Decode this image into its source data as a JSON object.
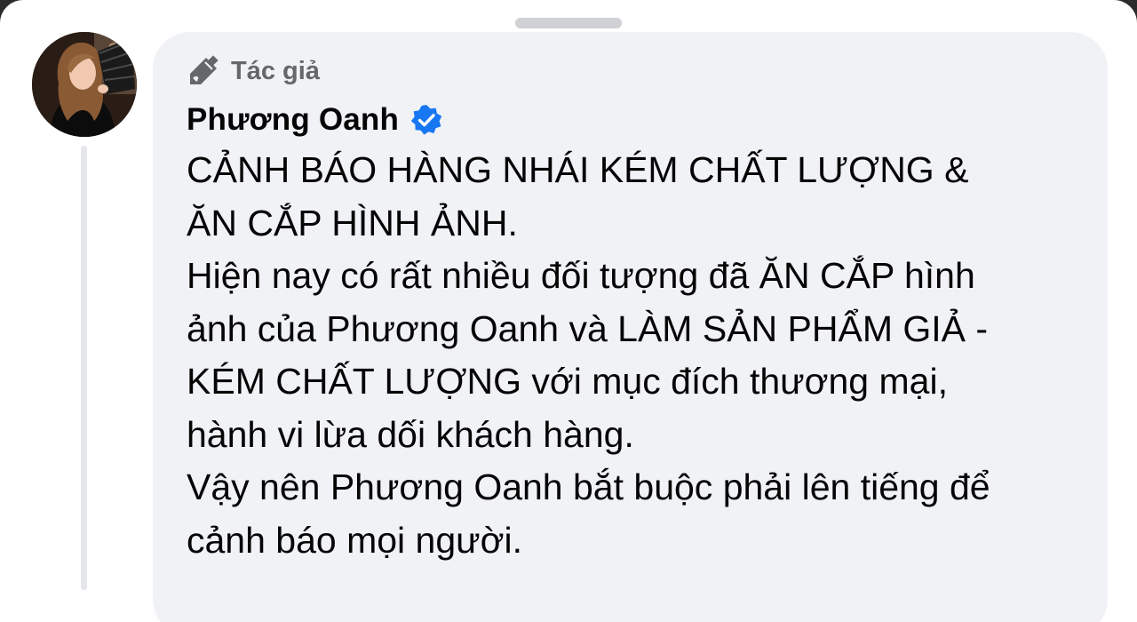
{
  "comment": {
    "badge": {
      "icon": "pen-icon",
      "label": "Tác giả"
    },
    "author": {
      "name": "Phương Oanh",
      "verified_icon": "verified-badge-icon",
      "verified_color": "#1877f2"
    },
    "lines": [
      "CẢNH BÁO HÀNG NHÁI KÉM CHẤT LƯỢNG &",
      "ĂN CẮP HÌNH ẢNH.",
      "Hiện nay có rất nhiều đối tượng đã ĂN CẮP hình",
      "ảnh của Phương Oanh và LÀM SẢN PHẨM GIẢ -",
      "KÉM CHẤT LƯỢNG với mục đích thương mại,",
      "hành vi lừa dối khách hàng.",
      "Vậy nên Phương Oanh bắt buộc phải lên tiếng để",
      "cảnh báo mọi người."
    ]
  },
  "colors": {
    "bubble_background": "#f0f2f5",
    "secondary_text": "#65676b",
    "primary_text": "#050505"
  }
}
